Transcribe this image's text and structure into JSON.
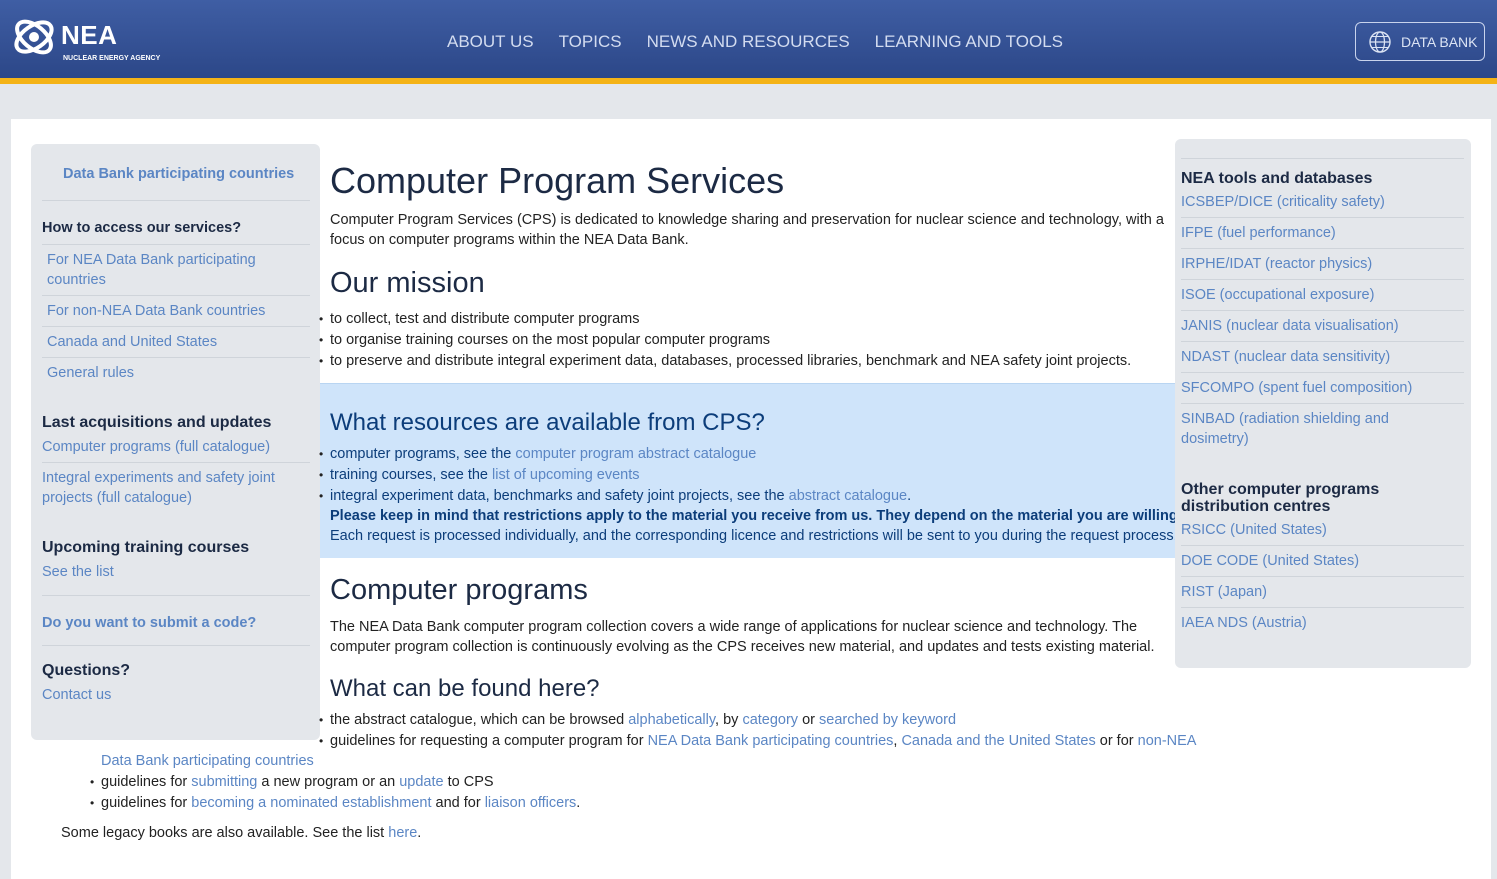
{
  "header": {
    "logo_text": "NEA",
    "logo_subtitle": "NUCLEAR ENERGY AGENCY",
    "nav": [
      "ABOUT US",
      "TOPICS",
      "NEWS AND RESOURCES",
      "LEARNING AND TOOLS"
    ],
    "databank_button": "DATA BANK",
    "colors": {
      "header_bg": "#3a579c",
      "accent_bar": "#f4b317"
    }
  },
  "left_sidebar": {
    "top_link": "Data Bank participating countries",
    "access_heading": "How to access our services?",
    "access_links": [
      "For NEA Data Bank participating countries",
      "For non-NEA Data Bank countries",
      "Canada and United States",
      "General rules"
    ],
    "acq_heading": "Last acquisitions and updates",
    "acq_links": [
      "Computer programs (full catalogue)",
      "Integral experiments and safety joint projects (full catalogue)"
    ],
    "training_heading": "Upcoming training courses",
    "training_link": "See the list",
    "submit_link": "Do you want to submit a code?",
    "questions_heading": "Questions?",
    "contact_link": "Contact us"
  },
  "main": {
    "title": "Computer Program Services",
    "intro": "Computer Program Services (CPS) is dedicated to knowledge sharing and preservation for nuclear science and technology, with a focus on computer programs within the NEA Data Bank.",
    "mission_heading": "Our mission",
    "mission_items": [
      "to collect, test and distribute computer programs",
      "to organise training courses on the most popular computer programs",
      "to preserve and distribute integral experiment data, databases, processed libraries, benchmark and NEA safety joint projects."
    ],
    "resources": {
      "heading": "What resources are available from CPS?",
      "item1_text": "computer programs, see the ",
      "item1_link": "computer program abstract catalogue",
      "item2_text": "training courses, see the ",
      "item2_link": "list of upcoming events",
      "item3_text": "integral experiment data, benchmarks and safety joint projects, see the ",
      "item3_link": "abstract catalogue",
      "item3_end": ".",
      "notice_bold": "Please keep in mind that restrictions apply to the material you receive from us. They depend on the material you are willing to obtain.",
      "notice": "Each request is processed individually, and the corresponding licence and restrictions will be sent to you during the request process."
    },
    "programs_heading": "Computer programs",
    "programs_text": "The NEA Data Bank computer program collection covers a wide range of applications for nuclear science and technology. The computer program collection is continuously evolving as the CPS receives new material, and updates and tests existing material.",
    "found_heading": "What can be found here?",
    "found1": {
      "t1": "the abstract catalogue, which can be browsed ",
      "l1": "alphabetically",
      "t2": ", by ",
      "l2": "category",
      "t3": " or ",
      "l3": "searched by keyword"
    },
    "found2": {
      "t1": "guidelines for requesting a computer program for ",
      "l1": "NEA Data Bank participating countries",
      "t2": ", ",
      "l2": "Canada and the United States",
      "t3": " or for ",
      "l3": "non-NEA",
      "l4": "Data Bank participating countries"
    },
    "found3": {
      "t1": "guidelines for ",
      "l1": "submitting",
      "t2": " a new program or an ",
      "l2": "update",
      "t3": " to CPS"
    },
    "found4": {
      "t1": "guidelines for ",
      "l1": "becoming a nominated establishment",
      "t2": " and for ",
      "l2": "liaison officers",
      "t3": "."
    },
    "legacy": {
      "t1": "Some legacy books are also available. See the list ",
      "l1": "here",
      "t2": "."
    }
  },
  "right_sidebar": {
    "tools_heading": "NEA tools and databases",
    "tools": [
      "ICSBEP/DICE (criticality safety)",
      "IFPE (fuel performance)",
      "IRPHE/IDAT (reactor physics)",
      "ISOE (occupational exposure)",
      "JANIS (nuclear data visualisation)",
      "NDAST (nuclear data sensitivity)",
      "SFCOMPO (spent fuel composition)",
      "SINBAD (radiation shielding and dosimetry)"
    ],
    "centres_heading": "Other computer programs distribution centres",
    "centres": [
      "RSICC (United States)",
      "DOE CODE (United States)",
      "RIST (Japan)",
      "IAEA NDS (Austria)"
    ]
  }
}
